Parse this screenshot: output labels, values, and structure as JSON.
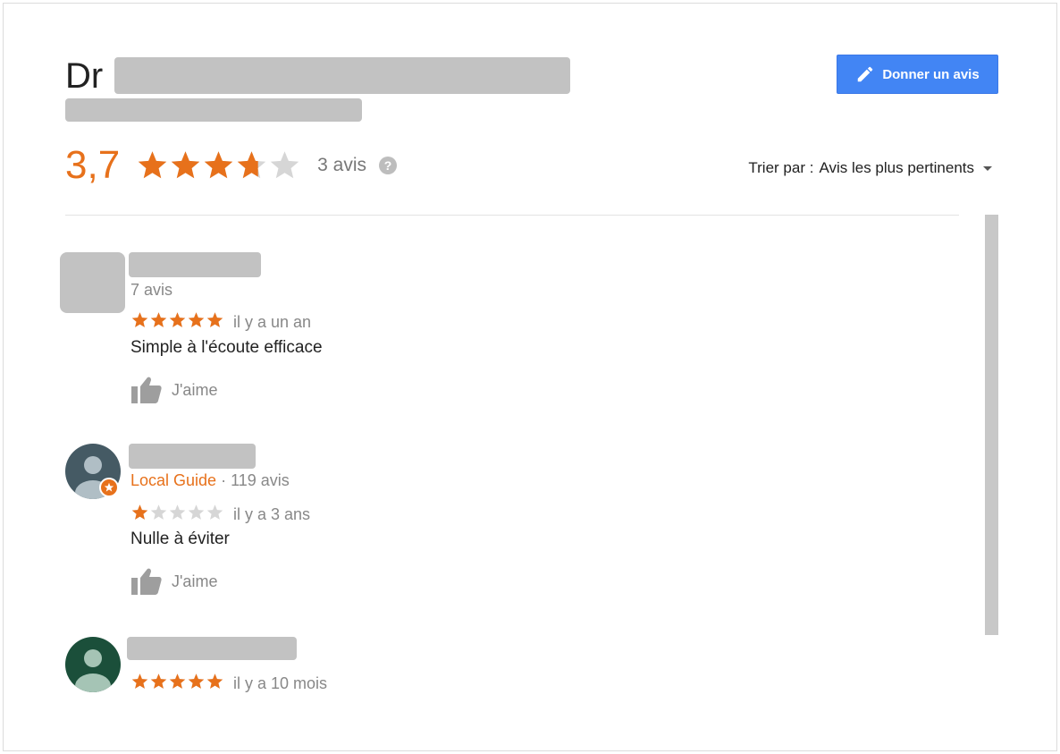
{
  "header": {
    "title_prefix": "Dr",
    "rate_button_label": "Donner un avis"
  },
  "summary": {
    "average": "3,7",
    "average_value": 3.7,
    "count_label": "3 avis",
    "help_glyph": "?"
  },
  "sort": {
    "label": "Trier par :",
    "value": "Avis les plus pertinents"
  },
  "colors": {
    "accent_orange": "#e7711b",
    "star_empty": "#d6d6d6",
    "button_blue": "#4285f4",
    "redaction_gray": "#c2c2c2"
  },
  "reviews": [
    {
      "meta": "7 avis",
      "rating": 5,
      "time": "il y a un an",
      "text": "Simple à l'écoute efficace",
      "like_label": "J'aime",
      "avatar_icon": "placeholder-avatar"
    },
    {
      "local_guide": "Local Guide",
      "meta": " · 119 avis",
      "rating": 1,
      "time": "il y a 3 ans",
      "text": "Nulle à éviter",
      "like_label": "J'aime",
      "avatar_icon": "person-icon",
      "avatar_color": "#455a64"
    },
    {
      "rating": 5,
      "time": "il y a 10 mois",
      "avatar_icon": "person-icon",
      "avatar_color": "#1b4f3a"
    }
  ]
}
